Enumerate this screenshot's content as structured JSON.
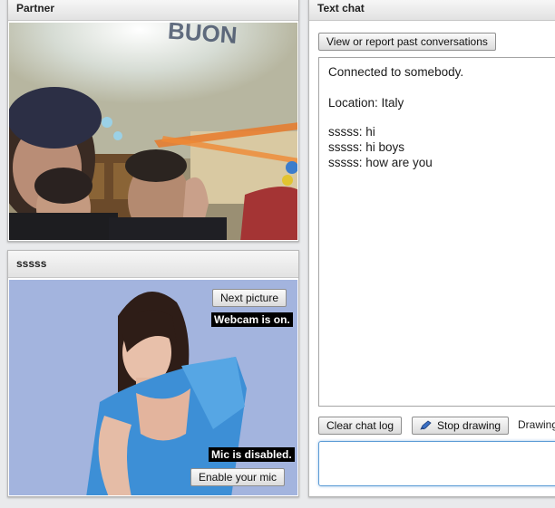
{
  "partner_panel": {
    "title": "Partner",
    "banner_text": "BUON"
  },
  "self_panel": {
    "title": "sssss",
    "next_picture_label": "Next picture",
    "webcam_status": "Webcam is on.",
    "mic_status": "Mic is disabled.",
    "enable_mic_label": "Enable your mic"
  },
  "chat_panel": {
    "title": "Text chat",
    "past_conversations_label": "View or report past conversations",
    "system_messages": [
      "Connected to somebody.",
      "Location: Italy"
    ],
    "messages": [
      {
        "sender": "sssss",
        "text": "hi"
      },
      {
        "sender": "sssss",
        "text": "hi boys"
      },
      {
        "sender": "sssss",
        "text": "how are you"
      }
    ],
    "clear_log_label": "Clear chat log",
    "stop_drawing_label": "Stop drawing",
    "drawing_label": "Drawing",
    "input_value": ""
  },
  "colors": {
    "accent_border": "#5b9bd5",
    "status_bg": "#000000"
  }
}
